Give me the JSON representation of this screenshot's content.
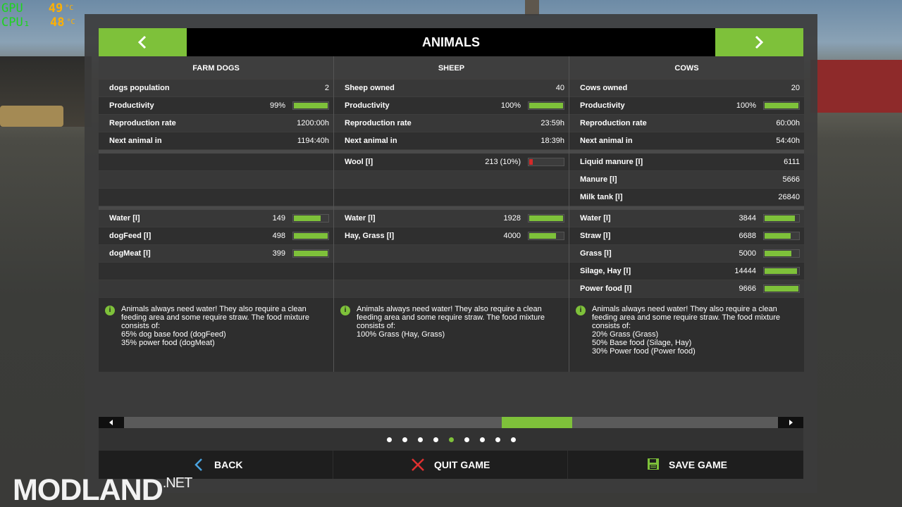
{
  "osd": {
    "gpu": {
      "label": "GPU",
      "value": "49",
      "unit": "°C"
    },
    "cpu": {
      "label": "CPU₁",
      "value": "48",
      "unit": "°C"
    }
  },
  "header": {
    "title": "ANIMALS"
  },
  "columns": [
    {
      "title": "FARM DOGS",
      "stats": [
        {
          "label": "dogs population",
          "value": "2"
        },
        {
          "label": "Productivity",
          "value": "99%",
          "level": 0.99
        },
        {
          "label": "Reproduction rate",
          "value": "1200:00h"
        },
        {
          "label": "Next animal in",
          "value": "1194:40h"
        }
      ],
      "products": [],
      "food": [
        {
          "label": "Water [l]",
          "value": "149",
          "level": 0.8
        },
        {
          "label": "dogFeed [l]",
          "value": "498",
          "level": 1.0
        },
        {
          "label": "dogMeat [l]",
          "value": "399",
          "level": 1.0
        }
      ],
      "info": {
        "text": "Animals always need water! They also require a clean feeding area and some require straw. The food mixture consists of:",
        "lines": [
          "65% dog base food (dogFeed)",
          "35% power food (dogMeat)"
        ]
      }
    },
    {
      "title": "SHEEP",
      "stats": [
        {
          "label": "Sheep owned",
          "value": "40"
        },
        {
          "label": "Productivity",
          "value": "100%",
          "level": 1.0
        },
        {
          "label": "Reproduction rate",
          "value": "23:59h"
        },
        {
          "label": "Next animal in",
          "value": "18:39h"
        }
      ],
      "products": [
        {
          "label": "Wool [l]",
          "value": "213 (10%)",
          "level": 0.1,
          "color": "#d42a2a"
        }
      ],
      "food": [
        {
          "label": "Water [l]",
          "value": "1928",
          "level": 1.0
        },
        {
          "label": "Hay, Grass [l]",
          "value": "4000",
          "level": 0.8
        }
      ],
      "info": {
        "text": "Animals always need water! They also require a clean feeding area and some require straw. The food mixture consists of:",
        "lines": [
          "100% Grass (Hay, Grass)"
        ]
      }
    },
    {
      "title": "COWS",
      "stats": [
        {
          "label": "Cows owned",
          "value": "20"
        },
        {
          "label": "Productivity",
          "value": "100%",
          "level": 1.0
        },
        {
          "label": "Reproduction rate",
          "value": "60:00h"
        },
        {
          "label": "Next animal in",
          "value": "54:40h"
        }
      ],
      "products": [
        {
          "label": "Liquid manure [l]",
          "value": "6111"
        },
        {
          "label": "Manure [l]",
          "value": "5666"
        },
        {
          "label": "Milk tank [l]",
          "value": "26840"
        }
      ],
      "food": [
        {
          "label": "Water [l]",
          "value": "3844",
          "level": 0.9
        },
        {
          "label": "Straw [l]",
          "value": "6688",
          "level": 0.78
        },
        {
          "label": "Grass [l]",
          "value": "5000",
          "level": 0.8
        },
        {
          "label": "Silage, Hay [l]",
          "value": "14444",
          "level": 0.95
        },
        {
          "label": "Power food [l]",
          "value": "9666",
          "level": 1.0
        }
      ],
      "info": {
        "text": "Animals always need water! They also require a clean feeding area and some require straw. The food mixture consists of:",
        "lines": [
          "20% Grass (Grass)",
          "50% Base food (Silage, Hay)",
          "30% Power food (Power food)"
        ]
      }
    }
  ],
  "pagination": {
    "count": 9,
    "active": 4
  },
  "footer": {
    "back": "BACK",
    "quit": "QUIT GAME",
    "save": "SAVE GAME"
  },
  "watermark": {
    "main": "MODLAND",
    "suffix": ".NET"
  },
  "colors": {
    "accent": "#7ec13a",
    "low": "#d42a2a"
  }
}
